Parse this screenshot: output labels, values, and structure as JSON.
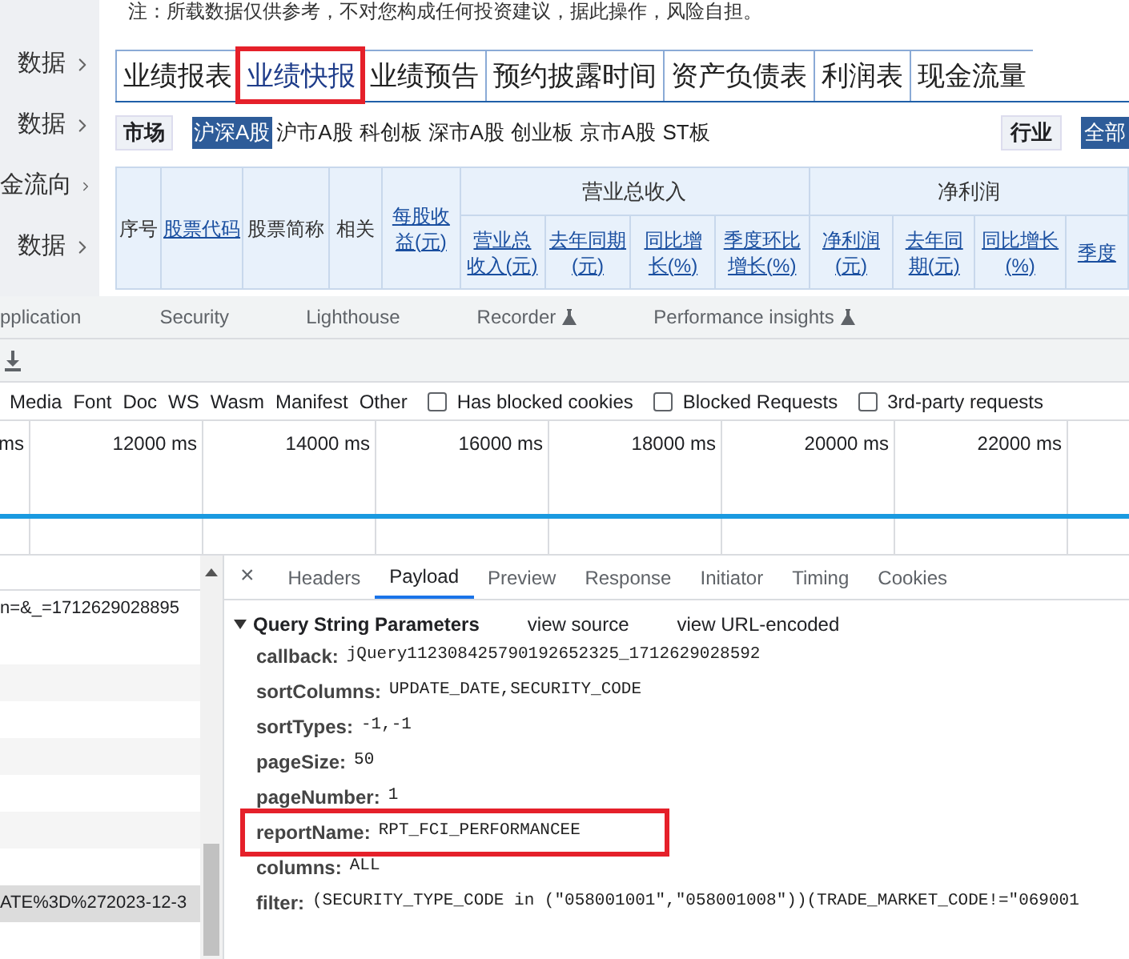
{
  "notice": "注：所载数据仅供参考，不对您构成任何投资建议，据此操作，风险自担。",
  "sidebar": {
    "items": [
      {
        "label": "数据"
      },
      {
        "label": "数据"
      },
      {
        "label": "金流向"
      },
      {
        "label": "数据"
      }
    ]
  },
  "report_tabs": [
    {
      "label": "业绩报表",
      "selected": false,
      "highlighted": false
    },
    {
      "label": "业绩快报",
      "selected": true,
      "highlighted": true
    },
    {
      "label": "业绩预告",
      "selected": false,
      "highlighted": false
    },
    {
      "label": "预约披露时间",
      "selected": false,
      "highlighted": false
    },
    {
      "label": "资产负债表",
      "selected": false,
      "highlighted": false
    },
    {
      "label": "利润表",
      "selected": false,
      "highlighted": false
    },
    {
      "label": "现金流量",
      "selected": false,
      "highlighted": false
    }
  ],
  "market": {
    "label": "市场",
    "options": [
      {
        "label": "沪深A股",
        "selected": true
      },
      {
        "label": "沪市A股",
        "selected": false
      },
      {
        "label": "科创板",
        "selected": false
      },
      {
        "label": "深市A股",
        "selected": false
      },
      {
        "label": "创业板",
        "selected": false
      },
      {
        "label": "京市A股",
        "selected": false
      },
      {
        "label": "ST板",
        "selected": false
      }
    ]
  },
  "industry": {
    "label": "行业",
    "options": [
      {
        "label": "全部",
        "selected": true
      }
    ]
  },
  "table": {
    "columns": [
      {
        "label": "序号",
        "link": false
      },
      {
        "label": "股票代码",
        "link": true
      },
      {
        "label": "股票简称",
        "link": false
      },
      {
        "label": "相关",
        "link": false
      },
      {
        "label": "每股收益(元)",
        "link": true
      }
    ],
    "groups": [
      {
        "label": "营业总收入",
        "columns": [
          {
            "label": "营业总收入(元)",
            "link": true
          },
          {
            "label": "去年同期(元)",
            "link": true
          },
          {
            "label": "同比增长(%)",
            "link": true
          },
          {
            "label": "季度环比增长(%)",
            "link": true
          }
        ]
      },
      {
        "label": "净利润",
        "columns": [
          {
            "label": "净利润(元)",
            "link": true
          },
          {
            "label": "去年同期(元)",
            "link": true
          },
          {
            "label": "同比增长(%)",
            "link": true
          },
          {
            "label": "季度",
            "link": true
          }
        ]
      }
    ]
  },
  "devtools": {
    "panels": [
      {
        "label": "pplication",
        "experimental": false
      },
      {
        "label": "Security",
        "experimental": false
      },
      {
        "label": "Lighthouse",
        "experimental": false
      },
      {
        "label": "Recorder",
        "experimental": true
      },
      {
        "label": "Performance insights",
        "experimental": true
      }
    ],
    "type_filters": [
      {
        "label": "Media"
      },
      {
        "label": "Font"
      },
      {
        "label": "Doc"
      },
      {
        "label": "WS"
      },
      {
        "label": "Wasm"
      },
      {
        "label": "Manifest"
      },
      {
        "label": "Other"
      }
    ],
    "checkboxes": [
      {
        "label": "Has blocked cookies",
        "checked": false
      },
      {
        "label": "Blocked Requests",
        "checked": false
      },
      {
        "label": "3rd-party requests",
        "checked": false
      }
    ],
    "timeline_ticks": [
      "ms",
      "12000 ms",
      "14000 ms",
      "16000 ms",
      "18000 ms",
      "20000 ms",
      "22000 ms"
    ],
    "requests": [
      {
        "text": "n=&_=1712629028895",
        "selected": false
      },
      {
        "text": "ATE%3D%272023-12-3",
        "selected": true
      }
    ],
    "detail_tabs": [
      {
        "label": "Headers",
        "selected": false
      },
      {
        "label": "Payload",
        "selected": true
      },
      {
        "label": "Preview",
        "selected": false
      },
      {
        "label": "Response",
        "selected": false
      },
      {
        "label": "Initiator",
        "selected": false
      },
      {
        "label": "Timing",
        "selected": false
      },
      {
        "label": "Cookies",
        "selected": false
      }
    ],
    "close": "×",
    "section": {
      "title": "Query String Parameters",
      "expanded": true,
      "links": [
        "view source",
        "view URL-encoded"
      ]
    },
    "params": [
      {
        "key": "callback:",
        "value": "jQuery112308425790192652325_1712629028592",
        "highlighted": false
      },
      {
        "key": "sortColumns:",
        "value": "UPDATE_DATE,SECURITY_CODE",
        "highlighted": false
      },
      {
        "key": "sortTypes:",
        "value": "-1,-1",
        "highlighted": false
      },
      {
        "key": "pageSize:",
        "value": "50",
        "highlighted": false
      },
      {
        "key": "pageNumber:",
        "value": "1",
        "highlighted": false
      },
      {
        "key": "reportName:",
        "value": "RPT_FCI_PERFORMANCEE",
        "highlighted": true
      },
      {
        "key": "columns:",
        "value": "ALL",
        "highlighted": false
      },
      {
        "key": "filter:",
        "value": "(SECURITY_TYPE_CODE in (\"058001001\",\"058001008\"))(TRADE_MARKET_CODE!=\"069001",
        "highlighted": false
      }
    ]
  }
}
